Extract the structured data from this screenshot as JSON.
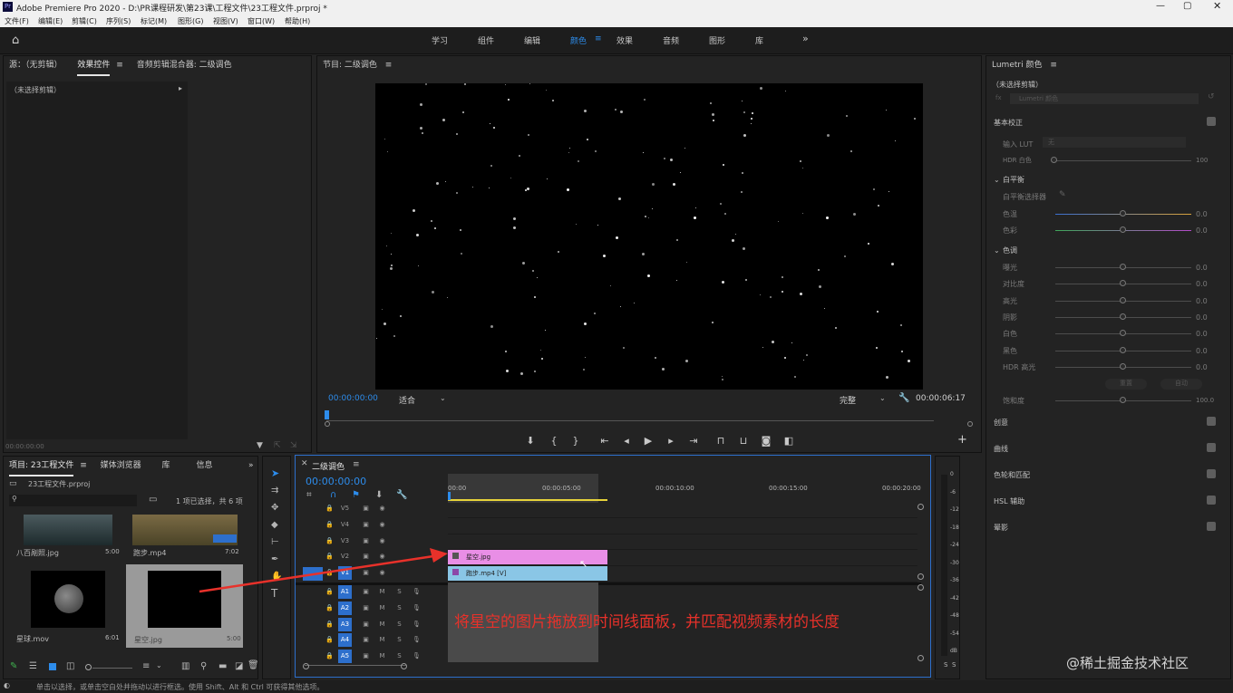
{
  "app": {
    "title": "Adobe Premiere Pro 2020 - D:\\PR课程研发\\第23课\\工程文件\\23工程文件.prproj *"
  },
  "menu": [
    "文件(F)",
    "编辑(E)",
    "剪辑(C)",
    "序列(S)",
    "标记(M)",
    "图形(G)",
    "视图(V)",
    "窗口(W)",
    "帮助(H)"
  ],
  "workspaces": [
    "学习",
    "组件",
    "编辑",
    "颜色",
    "效果",
    "音频",
    "图形",
    "库"
  ],
  "active_workspace": "颜色",
  "source_panel": {
    "tabs": [
      "源：（无剪辑）",
      "效果控件",
      "音频剪辑混合器: 二级调色"
    ],
    "no_clip": "（未选择剪辑）",
    "timecode": "00:00:00:00"
  },
  "program": {
    "title": "节目: 二级调色",
    "timecode_left": "00:00:00:00",
    "fit": "适合",
    "quality": "完整",
    "timecode_right": "00:00:06:17"
  },
  "lumetri": {
    "title": "Lumetri 颜色",
    "no_clip": "（未选择剪辑）",
    "preset": "Lumetri 颜色",
    "basic": "基本校正",
    "input_lut": "输入 LUT",
    "lut_value": "无",
    "hdr_white": "HDR 白色",
    "hdr_value": "100",
    "white_balance": "白平衡",
    "wb_selector": "白平衡选择器",
    "temp": "色温",
    "tint": "色彩",
    "tone": "色调",
    "exposure": "曝光",
    "contrast": "对比度",
    "highlights": "高光",
    "shadows": "阴影",
    "whites": "白色",
    "blacks": "黑色",
    "hdr_specular": "HDR 高光",
    "zero": "0.0",
    "reset": "重置",
    "auto": "自动",
    "saturation": "饱和度",
    "sat_value": "100.0",
    "creative": "创意",
    "curves": "曲线",
    "wheels": "色轮和匹配",
    "hsl": "HSL 辅助",
    "vignette": "晕影"
  },
  "project": {
    "tabs": [
      "项目: 23工程文件",
      "媒体浏览器",
      "库",
      "信息"
    ],
    "file": "23工程文件.prproj",
    "selection": "1 项已选择，共 6 项",
    "items": [
      {
        "name": "八百剐照.jpg",
        "dur": "5:00"
      },
      {
        "name": "跑步.mp4",
        "dur": "7:02"
      },
      {
        "name": "星球.mov",
        "dur": "6:01"
      },
      {
        "name": "星空.jpg",
        "dur": "5:00"
      }
    ]
  },
  "timeline": {
    "title": "二级调色",
    "timecode": "00:00:00:00",
    "ruler": [
      "00:00",
      "00:00:05:00",
      "00:00:10:00",
      "00:00:15:00",
      "00:00:20:00"
    ],
    "video_tracks": [
      "V5",
      "V4",
      "V3",
      "V2",
      "V1"
    ],
    "audio_tracks": [
      "A1",
      "A2",
      "A3",
      "A4",
      "A5"
    ],
    "clips": {
      "v2": "星空.jpg",
      "v1": "跑步.mp4 [V]"
    },
    "annotation": "将星空的图片拖放到时间线面板，并匹配视频素材的长度",
    "meter_scale": [
      "0",
      "-6",
      "-12",
      "-18",
      "-24",
      "-30",
      "-36",
      "-42",
      "-48",
      "-54",
      "dB"
    ]
  },
  "status": "单击以选择，或单击空白处并拖动以进行框选。使用 Shift、Alt 和 Ctrl 可获得其他选项。",
  "watermark": "@稀土掘金技术社区",
  "colors": {
    "accent": "#2d8ceb",
    "v2clip": "#e98ee6",
    "v1clip": "#8ac6e6",
    "annotation": "#e8312a"
  }
}
